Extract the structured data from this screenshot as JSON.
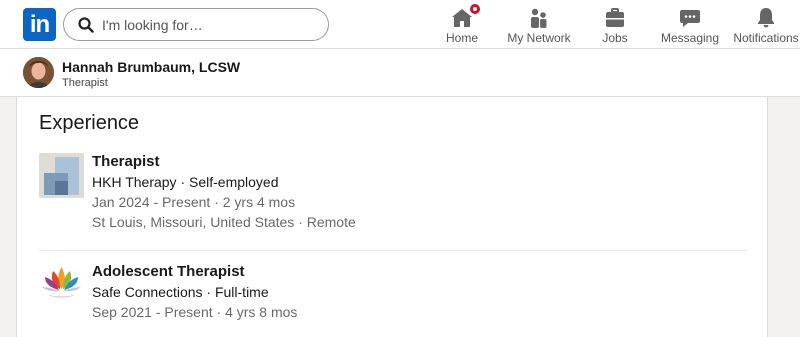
{
  "nav": {
    "logo_text": "in",
    "search_placeholder": "I'm looking for…",
    "items": [
      {
        "label": "Home",
        "icon": "home-icon",
        "has_badge": true
      },
      {
        "label": "My Network",
        "icon": "people-icon"
      },
      {
        "label": "Jobs",
        "icon": "briefcase-icon"
      },
      {
        "label": "Messaging",
        "icon": "chat-icon"
      },
      {
        "label": "Notifications",
        "icon": "bell-icon"
      }
    ]
  },
  "profile": {
    "name": "Hannah Brumbaum, LCSW",
    "headline": "Therapist"
  },
  "experience": {
    "title": "Experience",
    "items": [
      {
        "role": "Therapist",
        "org": "HKH Therapy · Self-employed",
        "dates": "Jan 2024 - Present · 2 yrs 4 mos",
        "location": "St Louis, Missouri, United States · Remote"
      },
      {
        "role": "Adolescent Therapist",
        "org": "Safe Connections · Full-time",
        "dates": "Sep 2021 - Present · 4 yrs 8 mos"
      }
    ]
  },
  "colors": {
    "brand": "#0a66c2",
    "badge": "#cb112d",
    "icon": "#666666"
  }
}
